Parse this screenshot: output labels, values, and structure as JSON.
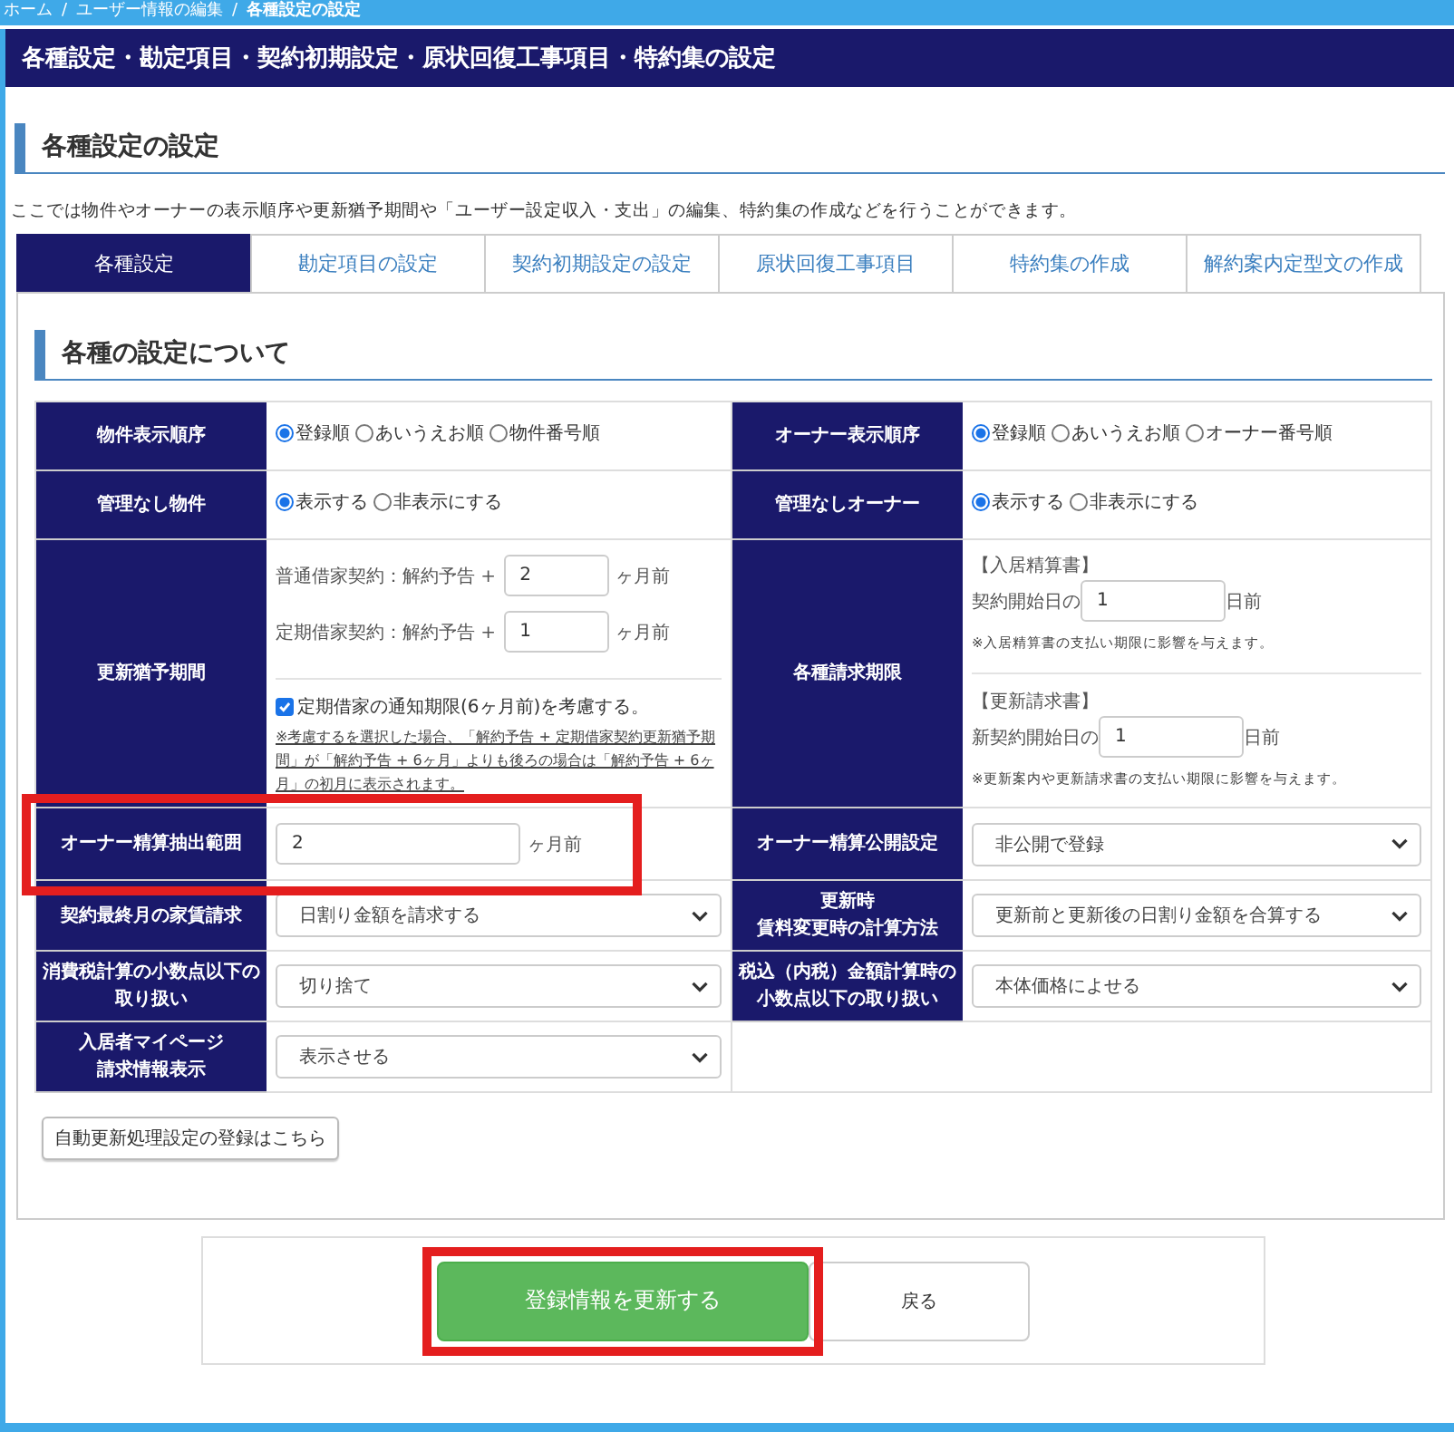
{
  "breadcrumb": {
    "separator": "/",
    "items": [
      "ホーム",
      "ユーザー情報の編集",
      "各種設定の設定"
    ]
  },
  "header": {
    "title": "各種設定・勘定項目・契約初期設定・原状回復工事項目・特約集の設定"
  },
  "section": {
    "title": "各種設定の設定",
    "description": "ここでは物件やオーナーの表示順序や更新猶予期間や「ユーザー設定収入・支出」の編集、特約集の作成などを行うことができます。"
  },
  "tabs": [
    {
      "label": "各種設定",
      "selected": true
    },
    {
      "label": "勘定項目の設定",
      "selected": false
    },
    {
      "label": "契約初期設定の設定",
      "selected": false
    },
    {
      "label": "原状回復工事項目",
      "selected": false
    },
    {
      "label": "特約集の作成",
      "selected": false
    },
    {
      "label": "解約案内定型文の作成",
      "selected": false
    }
  ],
  "panel": {
    "title": "各種の設定について",
    "rows": [
      [
        {
          "label": "物件表示順序",
          "kind": "radio",
          "highlighted": false,
          "options": [
            {
              "label": "登録順",
              "selected": true
            },
            {
              "label": "あいうえお順",
              "selected": false
            },
            {
              "label": "物件番号順",
              "selected": false
            }
          ]
        },
        {
          "label": "オーナー表示順序",
          "kind": "radio",
          "highlighted": false,
          "options": [
            {
              "label": "登録順",
              "selected": true
            },
            {
              "label": "あいうえお順",
              "selected": false
            },
            {
              "label": "オーナー番号順",
              "selected": false
            }
          ]
        }
      ],
      [
        {
          "label": "管理なし物件",
          "kind": "radio",
          "highlighted": false,
          "options": [
            {
              "label": "表示する",
              "selected": true
            },
            {
              "label": "非表示にする",
              "selected": false
            }
          ]
        },
        {
          "label": "管理なしオーナー",
          "kind": "radio",
          "highlighted": false,
          "options": [
            {
              "label": "表示する",
              "selected": true
            },
            {
              "label": "非表示にする",
              "selected": false
            }
          ]
        }
      ],
      [
        {
          "label": "更新猶予期間",
          "kind": "grace",
          "highlighted": false,
          "lines": [
            {
              "prefix": "普通借家契約：解約予告 +",
              "value": "2",
              "unit": "ヶ月前"
            },
            {
              "prefix": "定期借家契約：解約予告 +",
              "value": "1",
              "unit": "ヶ月前"
            }
          ],
          "checkbox": {
            "label": "定期借家の通知期限(6ヶ月前)を考慮する。",
            "checked": true
          },
          "note": "※考慮するを選択した場合、「解約予告 + 定期借家契約更新猶予期間」が「解約予告 + 6ヶ月」よりも後ろの場合は「解約予告 + 6ヶ月」の初月に表示されます。"
        },
        {
          "label": "各種請求期限",
          "kind": "deadlines",
          "highlighted": false,
          "groups": [
            {
              "heading": "【入居精算書】",
              "prefix": "契約開始日の",
              "value": "1",
              "unit": "日前",
              "note": "※入居精算書の支払い期限に影響を与えます。"
            },
            {
              "heading": "【更新請求書】",
              "prefix": "新契約開始日の",
              "value": "1",
              "unit": "日前",
              "note": "※更新案内や更新請求書の支払い期限に影響を与えます。"
            }
          ]
        }
      ],
      [
        {
          "label": "オーナー精算抽出範囲",
          "kind": "number",
          "highlighted": true,
          "value": "2",
          "unit": "ヶ月前"
        },
        {
          "label": "オーナー精算公開設定",
          "kind": "select",
          "highlighted": false,
          "value": "非公開で登録"
        }
      ],
      [
        {
          "label": "契約最終月の家賃請求",
          "kind": "select",
          "highlighted": false,
          "value": "日割り金額を請求する"
        },
        {
          "label_lines": [
            "更新時",
            "賃料変更時の計算方法"
          ],
          "kind": "select",
          "highlighted": false,
          "value": "更新前と更新後の日割り金額を合算する"
        }
      ],
      [
        {
          "label_lines": [
            "消費税計算の小数点以下の",
            "取り扱い"
          ],
          "kind": "select",
          "highlighted": false,
          "value": "切り捨て"
        },
        {
          "label_lines": [
            "税込（内税）金額計算時の",
            "小数点以下の取り扱い"
          ],
          "kind": "select",
          "highlighted": false,
          "value": "本体価格によせる"
        }
      ],
      [
        {
          "label_lines": [
            "入居者マイページ",
            "請求情報表示"
          ],
          "kind": "select",
          "highlighted": false,
          "value": "表示させる"
        }
      ]
    ],
    "link_button": "自動更新処理設定の登録はこちら"
  },
  "actions": [
    {
      "label": "登録情報を更新する",
      "kind": "primary",
      "highlighted": true
    },
    {
      "label": "戻る",
      "kind": "secondary",
      "highlighted": false
    }
  ]
}
